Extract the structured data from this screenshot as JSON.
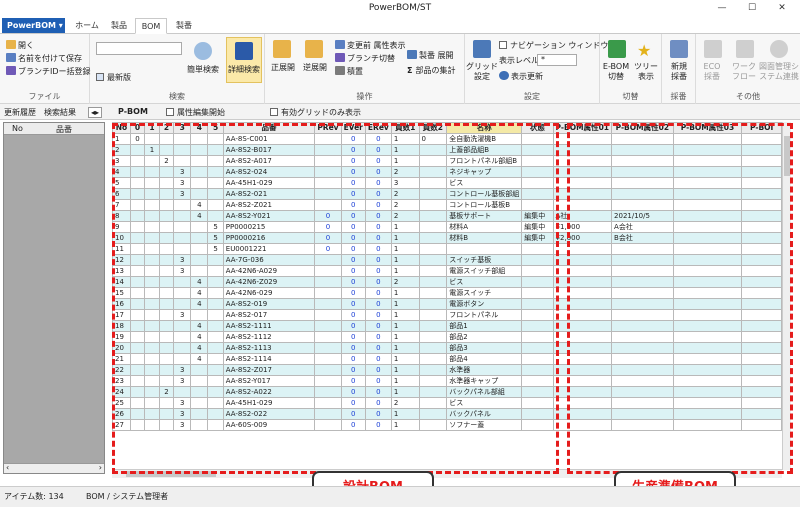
{
  "window": {
    "title": "PowerBOM/ST",
    "minimize": "—",
    "maximize": "☐",
    "close": "✕"
  },
  "app_button": "PowerBOM ▾",
  "tabs": [
    {
      "label": "ホーム"
    },
    {
      "label": "製品"
    },
    {
      "label": "BOM"
    },
    {
      "label": "製番"
    }
  ],
  "ribbon": {
    "file": {
      "label": "ファイル",
      "items": [
        "開く",
        "名前を付けて保存",
        "ブランチIDー括登録"
      ]
    },
    "search": {
      "label": "検索",
      "latest": "最新版",
      "simple": "簡単検索",
      "detail": "詳細検索"
    },
    "operation": {
      "label": "操作",
      "forward": "正展開",
      "reverse": "逆展開",
      "items": [
        "変更前 属性表示",
        "ブランチ切替",
        "積置",
        "製番 展開",
        "部品の集計"
      ]
    },
    "settings": {
      "label": "設定",
      "grid": "グリッド\n設定",
      "nav": "ナビゲーション ウィンドウ",
      "level_label": "表示レベル",
      "level_value": "*",
      "refresh": "表示更新"
    },
    "switch": {
      "label": "切替",
      "ebom": "E-BOM\n切替",
      "tree": "ツリー\n表示"
    },
    "adopt": {
      "label": "採番",
      "new": "新規\n採番"
    },
    "other": {
      "label": "その他",
      "items": [
        "ECO\n採番",
        "ワーク\nフロー",
        "図面管理シ\nステム連携"
      ]
    }
  },
  "subbar": {
    "history": "更新履歴",
    "results": "検索結果",
    "pbom": "P-BOM",
    "attr_edit": "属性編集開始",
    "valid_only": "有効グリッドのみ表示"
  },
  "left_pane": {
    "col_no": "No",
    "col_part": "品番"
  },
  "grid": {
    "headers": [
      "No",
      "0",
      "1",
      "2",
      "3",
      "4",
      "5",
      "品番",
      "PRev",
      "EVer",
      "ERev",
      "員数1",
      "員数2",
      "名称",
      "状態",
      "P-BOM属性01",
      "P-BOM属性02",
      "P-BOM属性03",
      "P-BOI"
    ],
    "rows": [
      [
        "1",
        "0",
        "",
        "",
        "",
        "",
        "",
        "AA-8S-C001",
        "",
        "0",
        "0",
        "1",
        "0",
        "全自動洗濯機B",
        "",
        "",
        "",
        "",
        ""
      ],
      [
        "2",
        "",
        "1",
        "",
        "",
        "",
        "",
        "AA-8S2-B017",
        "",
        "0",
        "0",
        "1",
        "",
        "上蓋部品組B",
        "",
        "",
        "",
        "",
        ""
      ],
      [
        "3",
        "",
        "",
        "2",
        "",
        "",
        "",
        "AA-8S2-A017",
        "",
        "0",
        "0",
        "1",
        "",
        "フロントパネル部組B",
        "",
        "",
        "",
        "",
        ""
      ],
      [
        "4",
        "",
        "",
        "",
        "3",
        "",
        "",
        "AA-8S2-024",
        "",
        "0",
        "0",
        "2",
        "",
        "ネジキャップ",
        "",
        "",
        "",
        "",
        ""
      ],
      [
        "5",
        "",
        "",
        "",
        "3",
        "",
        "",
        "AA-45H1-029",
        "",
        "0",
        "0",
        "3",
        "",
        "ビス",
        "",
        "",
        "",
        "",
        ""
      ],
      [
        "6",
        "",
        "",
        "",
        "3",
        "",
        "",
        "AA-8S2-021",
        "",
        "0",
        "0",
        "2",
        "",
        "コントロール基板部組",
        "",
        "",
        "",
        "",
        ""
      ],
      [
        "7",
        "",
        "",
        "",
        "",
        "4",
        "",
        "AA-8S2-Z021",
        "",
        "0",
        "0",
        "2",
        "",
        "コントロール基板B",
        "",
        "",
        "",
        "",
        ""
      ],
      [
        "8",
        "",
        "",
        "",
        "",
        "4",
        "",
        "AA-8S2-Y021",
        "0",
        "0",
        "0",
        "2",
        "",
        "基板サポート",
        "編集中",
        "A社",
        "2021/10/5",
        "",
        ""
      ],
      [
        "9",
        "",
        "",
        "",
        "",
        "",
        "5",
        "PP0000215",
        "0",
        "0",
        "0",
        "1",
        "",
        "材料A",
        "編集中",
        "¥1,000",
        "A会社",
        "",
        ""
      ],
      [
        "10",
        "",
        "",
        "",
        "",
        "",
        "5",
        "PP0000216",
        "0",
        "0",
        "0",
        "1",
        "",
        "材料B",
        "編集中",
        "¥2,000",
        "B会社",
        "",
        ""
      ],
      [
        "11",
        "",
        "",
        "",
        "",
        "",
        "5",
        "EU0001221",
        "0",
        "0",
        "0",
        "1",
        "",
        "",
        "",
        "",
        "",
        "",
        ""
      ],
      [
        "12",
        "",
        "",
        "",
        "3",
        "",
        "",
        "AA-7G-036",
        "",
        "0",
        "0",
        "1",
        "",
        "スイッチ基板",
        "",
        "",
        "",
        "",
        ""
      ],
      [
        "13",
        "",
        "",
        "",
        "3",
        "",
        "",
        "AA-42N6-A029",
        "",
        "0",
        "0",
        "1",
        "",
        "電源スイッチ部組",
        "",
        "",
        "",
        "",
        ""
      ],
      [
        "14",
        "",
        "",
        "",
        "",
        "4",
        "",
        "AA-42N6-Z029",
        "",
        "0",
        "0",
        "2",
        "",
        "ビス",
        "",
        "",
        "",
        "",
        ""
      ],
      [
        "15",
        "",
        "",
        "",
        "",
        "4",
        "",
        "AA-42N6-029",
        "",
        "0",
        "0",
        "1",
        "",
        "電源スイッチ",
        "",
        "",
        "",
        "",
        ""
      ],
      [
        "16",
        "",
        "",
        "",
        "",
        "4",
        "",
        "AA-8S2-019",
        "",
        "0",
        "0",
        "1",
        "",
        "電源ボタン",
        "",
        "",
        "",
        "",
        ""
      ],
      [
        "17",
        "",
        "",
        "",
        "3",
        "",
        "",
        "AA-8S2-017",
        "",
        "0",
        "0",
        "1",
        "",
        "フロントパネル",
        "",
        "",
        "",
        "",
        ""
      ],
      [
        "18",
        "",
        "",
        "",
        "",
        "4",
        "",
        "AA-8S2-1111",
        "",
        "0",
        "0",
        "1",
        "",
        "部品1",
        "",
        "",
        "",
        "",
        ""
      ],
      [
        "19",
        "",
        "",
        "",
        "",
        "4",
        "",
        "AA-8S2-1112",
        "",
        "0",
        "0",
        "1",
        "",
        "部品2",
        "",
        "",
        "",
        "",
        ""
      ],
      [
        "20",
        "",
        "",
        "",
        "",
        "4",
        "",
        "AA-8S2-1113",
        "",
        "0",
        "0",
        "1",
        "",
        "部品3",
        "",
        "",
        "",
        "",
        ""
      ],
      [
        "21",
        "",
        "",
        "",
        "",
        "4",
        "",
        "AA-8S2-1114",
        "",
        "0",
        "0",
        "1",
        "",
        "部品4",
        "",
        "",
        "",
        "",
        ""
      ],
      [
        "22",
        "",
        "",
        "",
        "3",
        "",
        "",
        "AA-8S2-Z017",
        "",
        "0",
        "0",
        "1",
        "",
        "水準器",
        "",
        "",
        "",
        "",
        ""
      ],
      [
        "23",
        "",
        "",
        "",
        "3",
        "",
        "",
        "AA-8S2-Y017",
        "",
        "0",
        "0",
        "1",
        "",
        "水準器キャップ",
        "",
        "",
        "",
        "",
        ""
      ],
      [
        "24",
        "",
        "",
        "2",
        "",
        "",
        "",
        "AA-8S2-A022",
        "",
        "0",
        "0",
        "1",
        "",
        "バックパネル部組",
        "",
        "",
        "",
        "",
        ""
      ],
      [
        "25",
        "",
        "",
        "",
        "3",
        "",
        "",
        "AA-45H1-029",
        "",
        "0",
        "0",
        "2",
        "",
        "ビス",
        "",
        "",
        "",
        "",
        ""
      ],
      [
        "26",
        "",
        "",
        "",
        "3",
        "",
        "",
        "AA-8S2-022",
        "",
        "0",
        "0",
        "1",
        "",
        "バックパネル",
        "",
        "",
        "",
        "",
        ""
      ],
      [
        "27",
        "",
        "",
        "",
        "3",
        "",
        "",
        "AA-60S-009",
        "",
        "0",
        "0",
        "1",
        "",
        "ソフナー蓋",
        "",
        "",
        "",
        "",
        ""
      ]
    ]
  },
  "callouts": {
    "design": "設計BOM",
    "production": "生産準備BOM"
  },
  "status": {
    "count": "アイテム数: 134",
    "user": "BOM / システム管理者"
  },
  "colors": {
    "accent": "#1f5fb4",
    "highlight": "#e51c1c",
    "row_alt": "#dcf3f5"
  }
}
